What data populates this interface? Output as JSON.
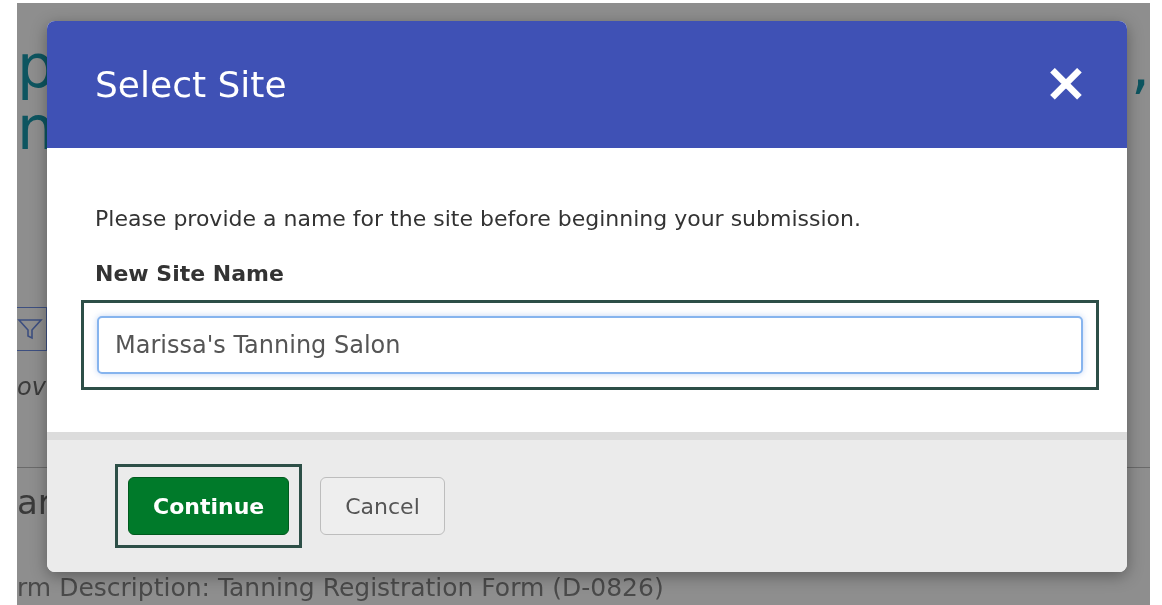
{
  "background": {
    "heading_lines": [
      "p",
      "n"
    ],
    "heading_trail": ",",
    "note": "ov",
    "section_title": "ar",
    "description": "rm Description: Tanning Registration Form (D-0826)"
  },
  "dialog": {
    "title": "Select Site",
    "close": "✕",
    "message": "Please provide a name for the site before beginning your submission.",
    "field": {
      "label": "New Site Name",
      "value": "Marissa's Tanning Salon",
      "focused": true,
      "highlighted": true
    },
    "buttons": [
      {
        "label": "Continue",
        "kind": "primary",
        "highlighted": true
      },
      {
        "label": "Cancel",
        "kind": "secondary",
        "highlighted": false
      }
    ]
  }
}
